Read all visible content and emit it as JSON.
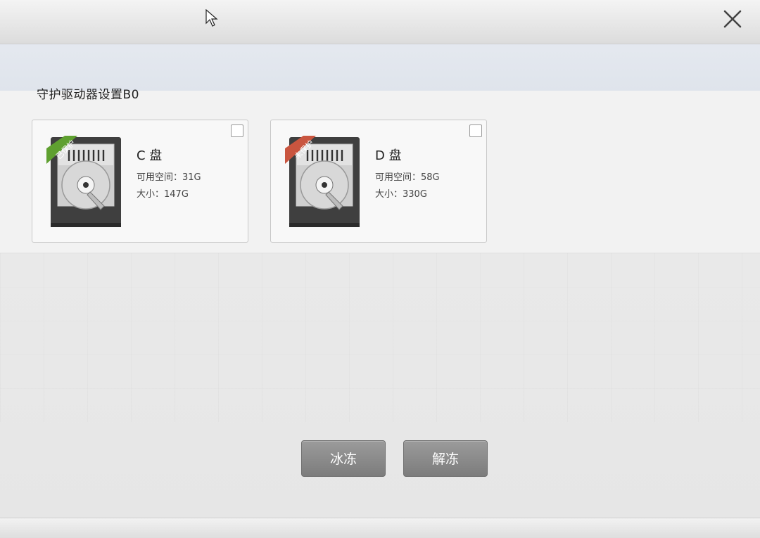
{
  "header": {
    "close_icon": "close-icon"
  },
  "section": {
    "title": "守护驱动器设置B0"
  },
  "drives": [
    {
      "name": "C 盘",
      "free": "可用空间：31G",
      "size": "大小：147G",
      "badge": "已保护",
      "badge_color": "#5fa030",
      "checked": false,
      "icon": "hard-disk-icon"
    },
    {
      "name": "D 盘",
      "free": "可用空间：58G",
      "size": "大小：330G",
      "badge": "未保护",
      "badge_color": "#c9553f",
      "checked": false,
      "icon": "hard-disk-icon"
    }
  ],
  "actions": {
    "freeze": "冰冻",
    "unfreeze": "解冻"
  }
}
